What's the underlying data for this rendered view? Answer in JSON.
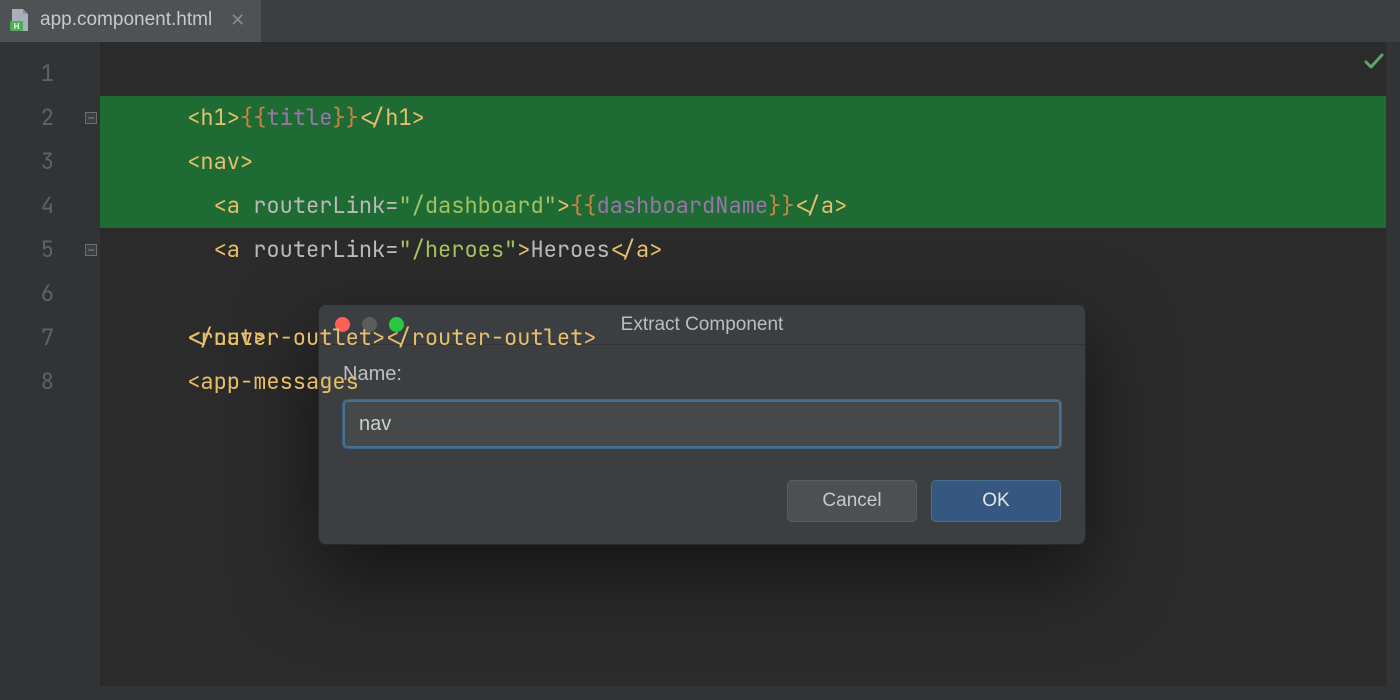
{
  "tab": {
    "filename": "app.component.html",
    "icon": "html-file-icon"
  },
  "gutter": {
    "lines": [
      "1",
      "2",
      "3",
      "4",
      "5",
      "6",
      "7",
      "8"
    ]
  },
  "code": {
    "l1": {
      "open": "<h1>",
      "mo": "{{",
      "var": "title",
      "mc": "}}",
      "close": "</h1>"
    },
    "l2": {
      "open": "<nav>"
    },
    "l3": {
      "indent": "  ",
      "aopen": "<a ",
      "attr": "routerLink",
      "eq": "=",
      "str": "\"/dashboard\"",
      "gt": ">",
      "mo": "{{",
      "var": "dashboardName",
      "mc": "}}",
      "aclose": "</a>"
    },
    "l4": {
      "indent": "  ",
      "aopen": "<a ",
      "attr": "routerLink",
      "eq": "=",
      "str": "\"/heroes\"",
      "gt": ">",
      "txt": "Heroes",
      "aclose": "</a>"
    },
    "l5": {
      "close": "</nav>"
    },
    "l6": {
      "open": "<router-outlet>",
      "close": "</router-outlet>"
    },
    "l7": {
      "partial": "<app-messages"
    },
    "l8": {
      "blank": " "
    }
  },
  "dialog": {
    "title": "Extract Component",
    "name_label": "Name:",
    "name_value": "nav",
    "cancel": "Cancel",
    "ok": "OK"
  }
}
